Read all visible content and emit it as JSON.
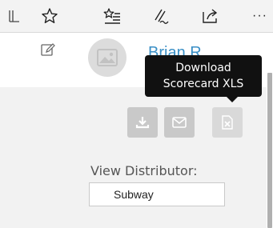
{
  "toolbar": {
    "icons": [
      "reading-view-icon",
      "favorite-star-icon",
      "favorites-hub-icon",
      "web-note-icon",
      "share-icon",
      "more-icon"
    ],
    "more_label": "···"
  },
  "profile": {
    "name": "Brian R",
    "icons": [
      "edit-icon",
      "avatar-image-icon"
    ]
  },
  "tooltip": {
    "line1": "Download",
    "line2": "Scorecard XLS"
  },
  "actions": {
    "icons": [
      "download-icon",
      "email-icon",
      "excel-file-icon"
    ]
  },
  "distributor": {
    "label": "View Distributor:",
    "value": "Subway"
  },
  "colors": {
    "link": "#3a8fc6",
    "button": "#c9c9c9",
    "tooltip_bg": "#111111",
    "panel_bg": "#f2f2f2"
  }
}
